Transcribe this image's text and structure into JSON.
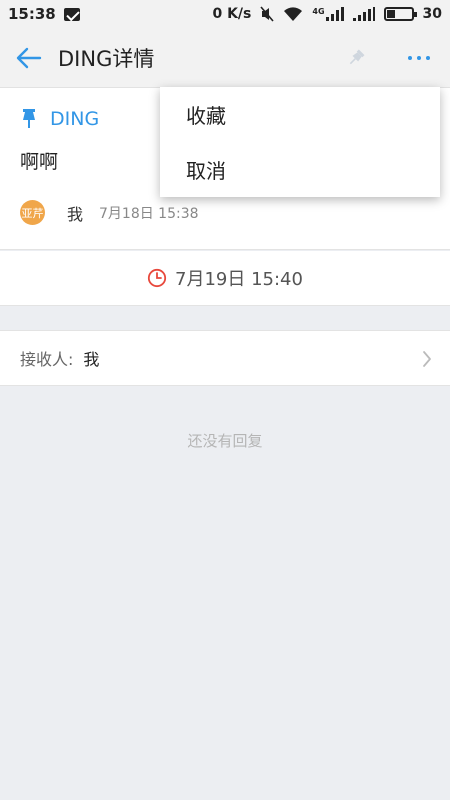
{
  "status_bar": {
    "time": "15:38",
    "network_speed": "0 K/s",
    "network_type": "4G",
    "battery": "30"
  },
  "app_bar": {
    "title": "DING详情"
  },
  "detail": {
    "ding_label": "DING",
    "message": "啊啊",
    "avatar_text": "亚芹",
    "sender": "我",
    "sent_time": "7月18日 15:38"
  },
  "reminder": {
    "time": "7月19日 15:40"
  },
  "receiver": {
    "label": "接收人:",
    "value": "我"
  },
  "replies": {
    "empty_text": "还没有回复"
  },
  "popup_menu": {
    "items": [
      {
        "label": "收藏"
      },
      {
        "label": "取消"
      }
    ]
  },
  "colors": {
    "accent": "#3296e6",
    "alarm": "#e8483c",
    "avatar": "#f0a64a"
  }
}
